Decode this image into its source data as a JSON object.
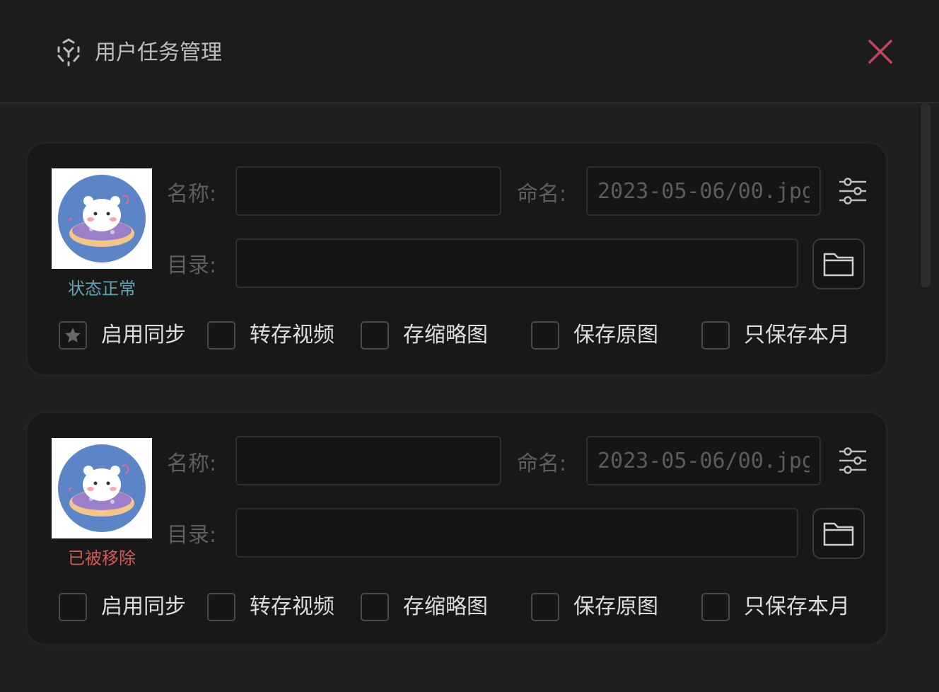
{
  "window": {
    "title": "用户任务管理",
    "accent_close": "#c8425d"
  },
  "field_labels": {
    "name": "名称:",
    "naming": "命名:",
    "dir": "目录:"
  },
  "cards": [
    {
      "status": "状态正常",
      "status_color": "#63a2b0",
      "name_value": "",
      "naming_placeholder": "2023-05-06/00.jpg",
      "dir_value": "",
      "options": [
        {
          "label": "启用同步",
          "checked": true
        },
        {
          "label": "转存视频",
          "checked": false
        },
        {
          "label": "存缩略图",
          "checked": false
        },
        {
          "label": "保存原图",
          "checked": false
        },
        {
          "label": "只保存本月",
          "checked": false
        }
      ]
    },
    {
      "status": "已被移除",
      "status_color": "#d35a55",
      "name_value": "",
      "naming_placeholder": "2023-05-06/00.jpg",
      "dir_value": "",
      "options": [
        {
          "label": "启用同步",
          "checked": false
        },
        {
          "label": "转存视频",
          "checked": false
        },
        {
          "label": "存缩略图",
          "checked": false
        },
        {
          "label": "保存原图",
          "checked": false
        },
        {
          "label": "只保存本月",
          "checked": false
        }
      ]
    }
  ],
  "icons": {
    "app": "ai-scan-icon",
    "close": "close-icon",
    "settings": "sliders-icon",
    "folder": "folder-icon",
    "checked_mark": "star-icon"
  }
}
